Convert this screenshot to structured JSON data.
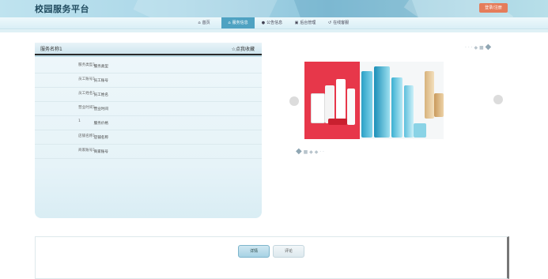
{
  "header": {
    "title": "校园服务平台",
    "login_label": "登录/注册"
  },
  "nav": {
    "items": [
      {
        "label": "首页",
        "icon": "home-icon",
        "glyph": "⌂"
      },
      {
        "label": "服务信息",
        "icon": "store-icon",
        "glyph": "⌂"
      },
      {
        "label": "公告信息",
        "icon": "info-icon",
        "glyph": "●"
      },
      {
        "label": "后台管理",
        "icon": "briefcase-icon",
        "glyph": "▣"
      },
      {
        "label": "在线客服",
        "icon": "refresh-icon",
        "glyph": "↺"
      }
    ],
    "active_index": 1
  },
  "detail": {
    "title": "服务名称1",
    "fav_label": "☆点我收藏",
    "fields": [
      {
        "label": "服务类型",
        "value": "服务类型1"
      },
      {
        "label": "员工账号",
        "value": "员工账号1"
      },
      {
        "label": "员工姓名",
        "value": "员工姓名1"
      },
      {
        "label": "营业时间",
        "value": "营业时间1"
      },
      {
        "label": "服务价格",
        "value": "1"
      },
      {
        "label": "店铺名称",
        "value": "店铺名称1"
      },
      {
        "label": "商家账号",
        "value": "商家账号1"
      }
    ]
  },
  "carousel": {
    "prev_icon": "chevron-left-icon",
    "next_icon": "chevron-right-icon"
  },
  "bottom_tabs": {
    "detail_label": "详情",
    "comment_label": "评论"
  },
  "colors": {
    "accent": "#4fa2c2",
    "login": "#e57c5a",
    "product_red": "#e7374a"
  }
}
